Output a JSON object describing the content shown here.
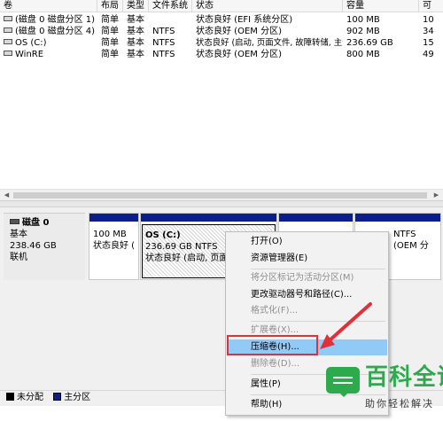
{
  "columns": [
    "卷",
    "布局",
    "类型",
    "文件系统",
    "状态",
    "容量",
    "可"
  ],
  "volumes": [
    {
      "name": "(磁盘 0 磁盘分区 1)",
      "layout": "简单",
      "type": "基本",
      "fs": "",
      "status": "状态良好 (EFI 系统分区)",
      "capacity": "100 MB",
      "free": "10"
    },
    {
      "name": "(磁盘 0 磁盘分区 4)",
      "layout": "简单",
      "type": "基本",
      "fs": "NTFS",
      "status": "状态良好 (OEM 分区)",
      "capacity": "902 MB",
      "free": "34"
    },
    {
      "name": "OS (C:)",
      "layout": "简单",
      "type": "基本",
      "fs": "NTFS",
      "status": "状态良好 (启动, 页面文件, 故障转储, 主分区)",
      "capacity": "236.69 GB",
      "free": "15"
    },
    {
      "name": "WinRE",
      "layout": "简单",
      "type": "基本",
      "fs": "NTFS",
      "status": "状态良好 (OEM 分区)",
      "capacity": "800 MB",
      "free": "49"
    }
  ],
  "disk": {
    "name": "磁盘 0",
    "type": "基本",
    "size": "238.46 GB",
    "status": "联机"
  },
  "partitions": {
    "p1": {
      "size": "100 MB",
      "status": "状态良好 ("
    },
    "p2": {
      "name": "OS  (C:)",
      "size": "236.69 GB NTFS",
      "status": "状态良好 (启动, 页面文"
    },
    "p4": {
      "size": "NTFS",
      "status": "(OEM 分"
    }
  },
  "legend": {
    "unallocated": "未分配",
    "primary": "主分区"
  },
  "context_menu": {
    "open": "打开(O)",
    "explorer": "资源管理器(E)",
    "mark_active": "将分区标记为活动分区(M)",
    "change_letter": "更改驱动器号和路径(C)...",
    "format": "格式化(F)...",
    "extend": "扩展卷(X)...",
    "shrink": "压缩卷(H)...",
    "delete": "删除卷(D)...",
    "properties": "属性(P)",
    "help": "帮助(H)"
  },
  "watermark": {
    "title": "百科全说",
    "subtitle": "助你轻松解决"
  },
  "colors": {
    "partition_bar": "#0a1e8c",
    "menu_highlight": "#91c9f7",
    "callout_red": "#e0303a",
    "brand_green": "#2dab4c"
  }
}
